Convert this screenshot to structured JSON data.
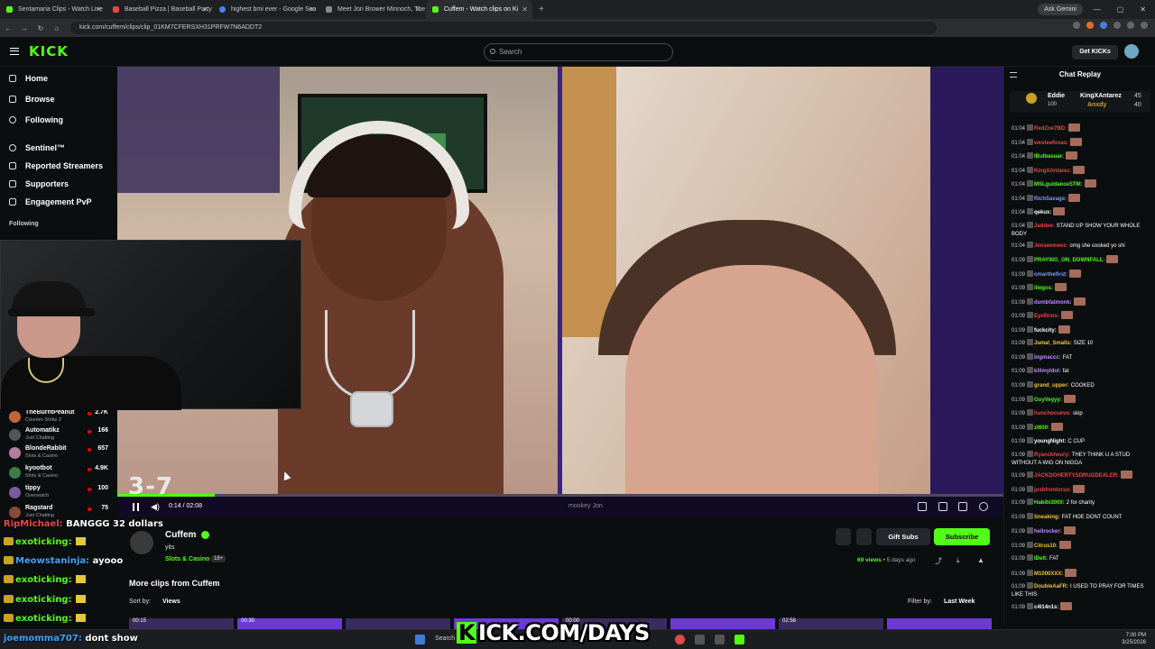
{
  "browser": {
    "tabs": [
      {
        "title": "Sentamaria Clips - Watch Live"
      },
      {
        "title": "Baseball Pizza | Baseball Party"
      },
      {
        "title": "highest bmi ever - Google Sea"
      },
      {
        "title": "Meet Jon Brower Minnoch, The"
      },
      {
        "title": "Cuffem - Watch clips on Ki"
      }
    ],
    "new_tab": "+",
    "url": "kick.com/cuffem/clips/clip_01KM7CFERSXH31PRFW7N6ADDT2",
    "gemini_label": "Ask Gemini"
  },
  "header": {
    "logo": "KICK",
    "search_placeholder": "Search",
    "get_kicks_label": "Get KICKs"
  },
  "sidebar": {
    "nav": [
      {
        "label": "Home"
      },
      {
        "label": "Browse"
      },
      {
        "label": "Following"
      }
    ],
    "groups": [
      {
        "label": "Sentinel™"
      },
      {
        "label": "Reported Streamers"
      },
      {
        "label": "Supporters"
      },
      {
        "label": "Engagement PvP"
      }
    ],
    "following_heading": "Following",
    "following": [
      {
        "name": "TheBurntPeanut",
        "category": "Counter-Strike 2",
        "viewers": "2.7K",
        "color": "#c2633b"
      },
      {
        "name": "Automatikz",
        "category": "Just Chatting",
        "viewers": "166",
        "color": "#555555"
      },
      {
        "name": "BlondeRabbit",
        "category": "Slots & Casino",
        "viewers": "657",
        "color": "#b07fa0"
      },
      {
        "name": "kyootbot",
        "category": "Slots & Casino",
        "viewers": "4.9K",
        "color": "#3f7a4c"
      },
      {
        "name": "tippy",
        "category": "Overwatch",
        "viewers": "100",
        "color": "#7a5a9a"
      },
      {
        "name": "Ragstard",
        "category": "Just Chatting",
        "viewers": "75",
        "color": "#8a4a3a"
      }
    ]
  },
  "player": {
    "score_overlay": "3-7",
    "time": "0:14 / 02:08",
    "progress": 0.11,
    "right_cam_tag": "mookey Jon"
  },
  "chat": {
    "title": "Chat Replay",
    "leaderboard": {
      "first_name": "Eddie",
      "first_score": "100",
      "second_name": "KingXAntarez",
      "second_score": "45",
      "third_name": "Anxdy",
      "third_score": "40"
    },
    "messages": [
      {
        "time": "01:04",
        "user": "RedZoe7BD:",
        "text": "",
        "color": "#e54848",
        "emote": true
      },
      {
        "time": "01:04",
        "user": "westeefonas:",
        "text": "",
        "color": "#e54848",
        "emote": true
      },
      {
        "time": "01:04",
        "user": "IBulbasuar:",
        "text": "",
        "color": "#53fc18",
        "emote": true
      },
      {
        "time": "01:04",
        "user": "KingXAntarez:",
        "text": "",
        "color": "#e54848",
        "emote": true
      },
      {
        "time": "01:04",
        "user": "MSLguidanceSTM:",
        "text": "",
        "color": "#53fc18",
        "emote": true
      },
      {
        "time": "01:04",
        "user": "RichSavage:",
        "text": "",
        "color": "#7a9cff",
        "emote": true
      },
      {
        "time": "01:04",
        "user": "qekux:",
        "text": "",
        "color": "#fff",
        "emote": true
      },
      {
        "time": "01:04",
        "user": "Jaddee:",
        "text": "STAND UP SHOW YOUR WHOLE BODY",
        "color": "#e54848",
        "emote": false
      },
      {
        "time": "01:04",
        "user": "Jenseemeez:",
        "text": "omg she cooked yo shi",
        "color": "#e54848",
        "emote": false
      },
      {
        "time": "01:09",
        "user": "PRAYING_ON_DOWNFALL:",
        "text": "",
        "color": "#53fc18",
        "emote": true
      },
      {
        "time": "01:09",
        "user": "omarthefirst:",
        "text": "",
        "color": "#7a9cff",
        "emote": true
      },
      {
        "time": "01:09",
        "user": "illegos:",
        "text": "",
        "color": "#53fc18",
        "emote": true
      },
      {
        "time": "01:09",
        "user": "dumbfatmonk:",
        "text": "",
        "color": "#c28aff",
        "emote": true
      },
      {
        "time": "01:09",
        "user": "EyeDnos:",
        "text": "",
        "color": "#e54848",
        "emote": true
      },
      {
        "time": "01:09",
        "user": "fuckcity:",
        "text": "",
        "color": "#fff",
        "emote": true
      },
      {
        "time": "01:09",
        "user": "Jamal_Smalls:",
        "text": "SIZE 10",
        "color": "#f0c23a",
        "emote": false
      },
      {
        "time": "01:09",
        "user": "bigmaccc:",
        "text": "FAT",
        "color": "#c28aff",
        "emote": false
      },
      {
        "time": "01:09",
        "user": "killmyldol:",
        "text": "fat",
        "color": "#c28aff",
        "emote": false
      },
      {
        "time": "01:09",
        "user": "grand_upper:",
        "text": "COOKED",
        "color": "#f0c23a",
        "emote": false
      },
      {
        "time": "01:09",
        "user": "GoyVeyyy:",
        "text": "",
        "color": "#53fc18",
        "emote": true
      },
      {
        "time": "01:09",
        "user": "hunchocuevo:",
        "text": "skip",
        "color": "#e54848",
        "emote": false
      },
      {
        "time": "01:09",
        "user": "zt600:",
        "text": "",
        "color": "#53fc18",
        "emote": true
      },
      {
        "time": "01:09",
        "user": "youngNight:",
        "text": "C CUP",
        "color": "#fff",
        "emote": false
      },
      {
        "time": "01:09",
        "user": "Ryanckheury:",
        "text": "THEY THINK U A STUD WITHOUT A WIG ON NIGGA",
        "color": "#e54848",
        "emote": false
      },
      {
        "time": "01:09",
        "user": "JACKDOHERTYSDRUGDEALER:",
        "text": "",
        "color": "#e54848",
        "emote": true
      },
      {
        "time": "01:09",
        "user": "joshfrontorso:",
        "text": "",
        "color": "#e54848",
        "emote": true
      },
      {
        "time": "01:09",
        "user": "Habibi3000:",
        "text": "2 for charity",
        "color": "#53fc18",
        "emote": false
      },
      {
        "time": "01:09",
        "user": "Sneaking:",
        "text": "FAT HOE DONT COUNT",
        "color": "#f0c23a",
        "emote": false
      },
      {
        "time": "01:09",
        "user": "hellrocker:",
        "text": "",
        "color": "#c28aff",
        "emote": true
      },
      {
        "time": "01:09",
        "user": "Citrus10:",
        "text": "",
        "color": "#f0c23a",
        "emote": true
      },
      {
        "time": "01:09",
        "user": "IDelt:",
        "text": "FAT",
        "color": "#53fc18",
        "emote": false
      },
      {
        "time": "01:09",
        "user": "M1000XXX:",
        "text": "",
        "color": "#f0c23a",
        "emote": true
      },
      {
        "time": "01:09",
        "user": "DoubleAaFR:",
        "text": "I USED TO PRAY FOR TIMES LIKE THIS",
        "color": "#f0c23a",
        "emote": false
      },
      {
        "time": "01:09",
        "user": "c4l14n1s:",
        "text": "",
        "color": "#fff",
        "emote": true
      }
    ]
  },
  "clip_info": {
    "channel": "Cuffem",
    "title": "yits",
    "category": "Slots & Casino",
    "age_badge": "18+",
    "gift_label": "Gift Subs",
    "subscribe_label": "Subscribe",
    "views_count": "69 views",
    "views_when": "• 5 days ago",
    "more_clips": "More clips from Cuffem",
    "sort_label": "Sort by:",
    "sort_value": "Views",
    "filter_label": "Filter by:",
    "filter_value": "Last Week",
    "thumb_times": [
      "00:15",
      "00:30",
      "",
      "",
      "00:00",
      "",
      "02:58",
      ""
    ]
  },
  "overlay_chat": [
    {
      "user": "RipMichael:",
      "text": "BANGGG 32 dollars",
      "color": "#e54848"
    },
    {
      "user": "exoticking:",
      "text": "",
      "color": "#53fc18"
    },
    {
      "user": "Meowstaninja:",
      "text": "ayooo",
      "color": "#3ba6ff"
    },
    {
      "user": "exoticking:",
      "text": "",
      "color": "#53fc18"
    },
    {
      "user": "exoticking:",
      "text": "",
      "color": "#53fc18"
    },
    {
      "user": "exoticking:",
      "text": "",
      "color": "#53fc18"
    },
    {
      "user": "joemomma707:",
      "text": "dont show",
      "color": "#3ba6ff"
    }
  ],
  "banner": {
    "text": "KICK.COM/DAYS"
  },
  "taskbar": {
    "search_label": "Search",
    "time": "7:00 PM",
    "date": "3/25/2026"
  },
  "colors": {
    "accent": "#53fc18",
    "bg": "#0b0e0f"
  }
}
